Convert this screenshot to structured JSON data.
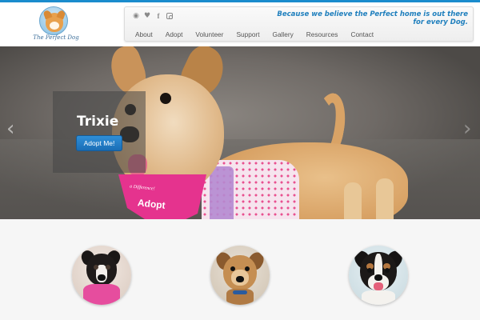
{
  "header": {
    "logo_text": "The Perfect Dog",
    "tagline": "Because we believe the Perfect home is out there for every Dog.",
    "social_icons": [
      "rss-icon",
      "twitter-icon",
      "facebook-icon",
      "instagram-icon"
    ],
    "nav": [
      {
        "label": "About"
      },
      {
        "label": "Adopt"
      },
      {
        "label": "Volunteer"
      },
      {
        "label": "Support"
      },
      {
        "label": "Gallery"
      },
      {
        "label": "Resources"
      },
      {
        "label": "Contact"
      }
    ]
  },
  "hero": {
    "dog_name": "Trixie",
    "button_label": "Adopt Me!",
    "bandana_text": "Adopt",
    "bandana_small_text": "a Difference!",
    "prev_arrow": "‹",
    "next_arrow": "›"
  },
  "featured": {
    "thumbnails": [
      "dog-thumbnail-1",
      "dog-thumbnail-2",
      "dog-thumbnail-3"
    ]
  },
  "colors": {
    "accent": "#1a8ccd",
    "tagline": "#1f7fbd",
    "button": "#1a6db5",
    "bandana": "#e5338e"
  }
}
